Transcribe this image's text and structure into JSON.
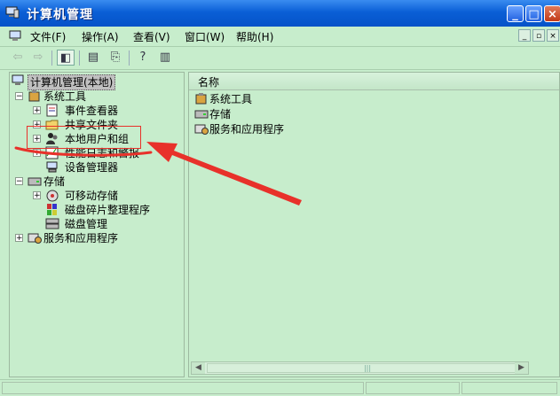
{
  "window": {
    "title": "计算机管理",
    "controls": {
      "minimize": "_",
      "maximize": "□",
      "close": "×"
    }
  },
  "menubar": {
    "items": [
      "文件(F)",
      "操作(A)",
      "查看(V)",
      "窗口(W)",
      "帮助(H)"
    ],
    "mdi_controls": [
      "_",
      "▫",
      "×"
    ]
  },
  "toolbar": {
    "buttons": [
      "back-icon",
      "forward-icon",
      "show-hide-tree-icon",
      "properties-icon",
      "export-list-icon",
      "help-icon",
      "show-hide-action-pane-icon"
    ]
  },
  "tree": {
    "root": "计算机管理(本地)",
    "system_tools": {
      "label": "系统工具",
      "children": [
        "事件查看器",
        "共享文件夹",
        "本地用户和组",
        "性能日志和警报",
        "设备管理器"
      ]
    },
    "storage": {
      "label": "存储",
      "children": [
        "可移动存储",
        "磁盘碎片整理程序",
        "磁盘管理"
      ]
    },
    "services": {
      "label": "服务和应用程序"
    }
  },
  "list": {
    "column_header": "名称",
    "items": [
      "系统工具",
      "存储",
      "服务和应用程序"
    ]
  },
  "annotation": {
    "color": "#e8312a"
  },
  "colors": {
    "background": "#c7edcc",
    "titlebar": "#0a5fd6"
  }
}
